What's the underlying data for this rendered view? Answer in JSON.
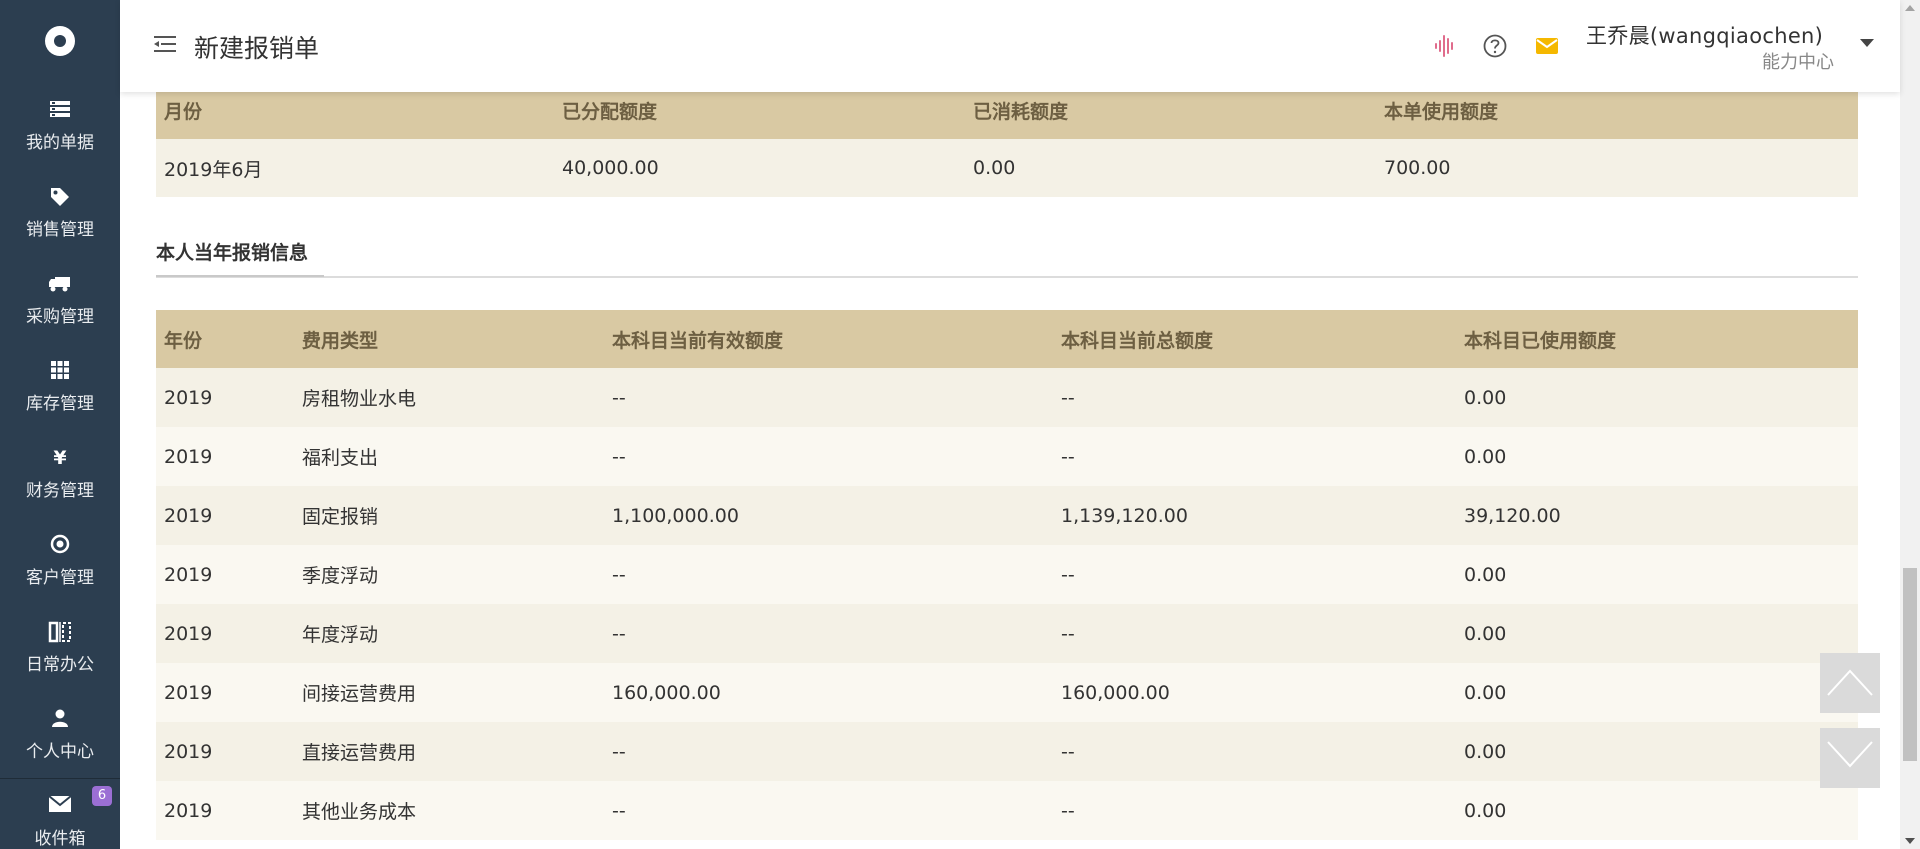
{
  "sidebar": {
    "items": [
      {
        "label": "我的单据",
        "icon": "list-icon"
      },
      {
        "label": "销售管理",
        "icon": "tag-icon"
      },
      {
        "label": "采购管理",
        "icon": "truck-icon"
      },
      {
        "label": "库存管理",
        "icon": "grid-icon"
      },
      {
        "label": "财务管理",
        "icon": "yen-icon"
      },
      {
        "label": "客户管理",
        "icon": "target-icon"
      },
      {
        "label": "日常办公",
        "icon": "columns-icon"
      },
      {
        "label": "个人中心",
        "icon": "user-icon"
      },
      {
        "label": "收件箱",
        "icon": "envelope-icon",
        "badge": "6"
      }
    ]
  },
  "header": {
    "title": "新建报销单",
    "user_name": "王乔晨(wangqiaochen)",
    "user_dept": "能力中心",
    "icon_colors": {
      "audio": "#e06c8c",
      "help": "#555555",
      "mail": "#f5b800"
    }
  },
  "quota_table": {
    "headers": [
      "月份",
      "已分配额度",
      "已消耗额度",
      "本单使用额度"
    ],
    "rows": [
      [
        "2019年6月",
        "40,000.00",
        "0.00",
        "700.00"
      ]
    ]
  },
  "annual_section": {
    "title": "本人当年报销信息",
    "headers": [
      "年份",
      "费用类型",
      "本科目当前有效额度",
      "本科目当前总额度",
      "本科目已使用额度"
    ],
    "rows": [
      [
        "2019",
        "房租物业水电",
        "--",
        "--",
        "0.00"
      ],
      [
        "2019",
        "福利支出",
        "--",
        "--",
        "0.00"
      ],
      [
        "2019",
        "固定报销",
        "1,100,000.00",
        "1,139,120.00",
        "39,120.00"
      ],
      [
        "2019",
        "季度浮动",
        "--",
        "--",
        "0.00"
      ],
      [
        "2019",
        "年度浮动",
        "--",
        "--",
        "0.00"
      ],
      [
        "2019",
        "间接运营费用",
        "160,000.00",
        "160,000.00",
        "0.00"
      ],
      [
        "2019",
        "直接运营费用",
        "--",
        "--",
        "0.00"
      ],
      [
        "2019",
        "其他业务成本",
        "--",
        "--",
        "0.00"
      ]
    ]
  },
  "colors": {
    "sidebar_bg": "#2c3e50",
    "table_header_bg": "#d9c9a3",
    "table_header_text": "#6d5f42",
    "row_a": "#f4f1e6",
    "row_b": "#faf8f1",
    "badge": "#9b6fd4"
  }
}
